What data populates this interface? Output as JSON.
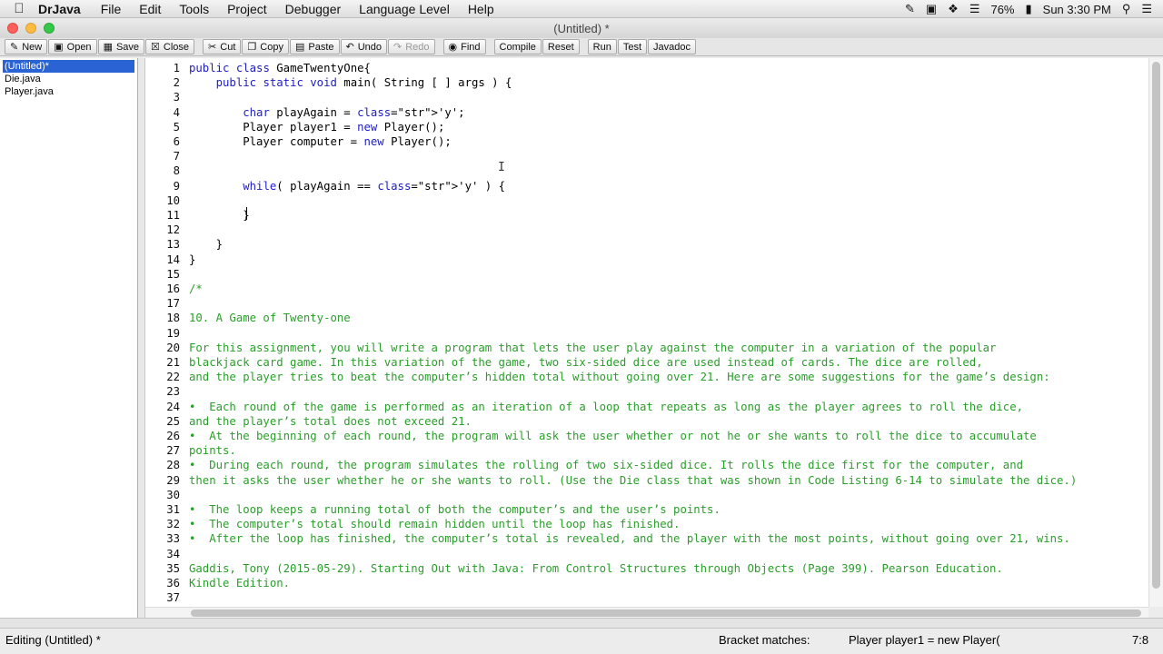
{
  "menubar": {
    "app": "DrJava",
    "items": [
      "File",
      "Edit",
      "Tools",
      "Project",
      "Debugger",
      "Language Level",
      "Help"
    ],
    "battery": "76%",
    "clock": "Sun 3:30 PM",
    "icons": [
      "pen-icon",
      "display-icon",
      "dropbox-icon",
      "wifi-icon",
      "battery-icon",
      "spotlight-icon",
      "menu-list-icon"
    ]
  },
  "window": {
    "title": "(Untitled) *"
  },
  "toolbar": {
    "new": "New",
    "open": "Open",
    "save": "Save",
    "close": "Close",
    "cut": "Cut",
    "copy": "Copy",
    "paste": "Paste",
    "undo": "Undo",
    "redo": "Redo",
    "find": "Find",
    "compile": "Compile",
    "reset": "Reset",
    "run": "Run",
    "test": "Test",
    "javadoc": "Javadoc"
  },
  "files": [
    "(Untitled)*",
    "Die.java",
    "Player.java"
  ],
  "editor": {
    "lines": [
      "public class GameTwentyOne{",
      "    public static void main( String [ ] args ) {",
      "",
      "        char playAgain = 'y';",
      "        Player player1 = new Player();",
      "        Player computer = new Player();",
      "        ",
      "",
      "        while( playAgain == 'y' ) {",
      "",
      "        }",
      "",
      "    }",
      "}",
      "",
      "/*",
      "",
      "10. A Game of Twenty-one",
      "",
      "For this assignment, you will write a program that lets the user play against the computer in a variation of the popular",
      "blackjack card game. In this variation of the game, two six-sided dice are used instead of cards. The dice are rolled,",
      "and the player tries to beat the computer’s hidden total without going over 21. Here are some suggestions for the game’s design:",
      "",
      "•  Each round of the game is performed as an iteration of a loop that repeats as long as the player agrees to roll the dice,",
      "and the player’s total does not exceed 21.",
      "•  At the beginning of each round, the program will ask the user whether or not he or she wants to roll the dice to accumulate",
      "points.",
      "•  During each round, the program simulates the rolling of two six-sided dice. It rolls the dice first for the computer, and",
      "then it asks the user whether he or she wants to roll. (Use the Die class that was shown in Code Listing 6-14 to simulate the dice.)",
      "",
      "•  The loop keeps a running total of both the computer’s and the user’s points.",
      "•  The computer’s total should remain hidden until the loop has finished.",
      "•  After the loop has finished, the computer’s total is revealed, and the player with the most points, without going over 21, wins.",
      "",
      "Gaddis, Tony (2015-05-29). Starting Out with Java: From Control Structures through Objects (Page 399). Pearson Education.",
      "Kindle Edition.",
      ""
    ]
  },
  "status": {
    "editing": "Editing (Untitled) *",
    "bracket_label": "Bracket matches:",
    "bracket_value": "Player player1 = new Player(",
    "position": "7:8"
  }
}
